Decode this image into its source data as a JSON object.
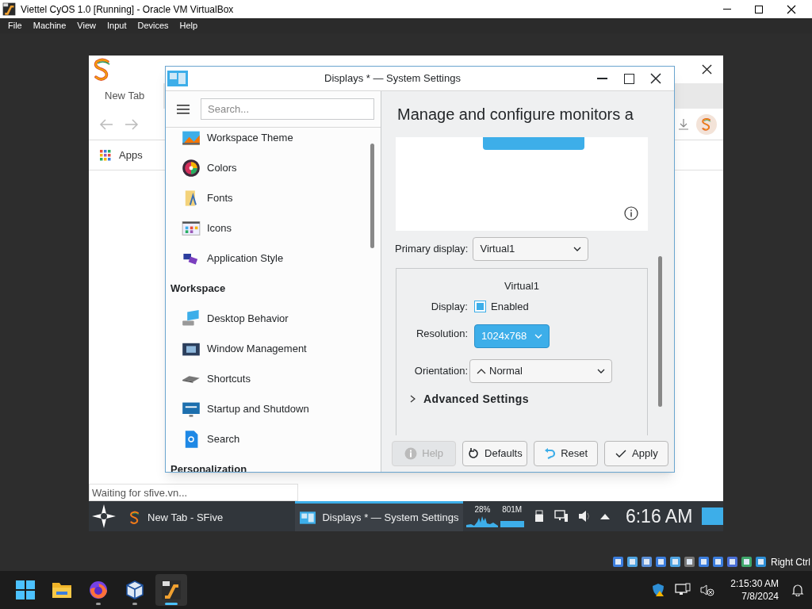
{
  "vbox": {
    "title": "Viettel CyOS 1.0 [Running] - Oracle VM VirtualBox",
    "menu": [
      "File",
      "Machine",
      "View",
      "Input",
      "Devices",
      "Help"
    ],
    "host_key": "Right Ctrl"
  },
  "browser": {
    "tab": "New Tab",
    "bookmarks": [
      "Apps"
    ],
    "status": "Waiting for sfive.vn..."
  },
  "settings": {
    "title": "Displays * — System Settings",
    "search": {
      "placeholder": "Search..."
    },
    "sidebar": [
      {
        "kind": "item",
        "label": "Workspace Theme"
      },
      {
        "kind": "item",
        "label": "Colors"
      },
      {
        "kind": "item",
        "label": "Fonts"
      },
      {
        "kind": "item",
        "label": "Icons"
      },
      {
        "kind": "item",
        "label": "Application Style"
      },
      {
        "kind": "header",
        "label": "Workspace"
      },
      {
        "kind": "item",
        "label": "Desktop Behavior"
      },
      {
        "kind": "item",
        "label": "Window Management"
      },
      {
        "kind": "item",
        "label": "Shortcuts"
      },
      {
        "kind": "item",
        "label": "Startup and Shutdown"
      },
      {
        "kind": "item",
        "label": "Search"
      },
      {
        "kind": "header",
        "label": "Personalization"
      }
    ],
    "heading": "Manage and configure monitors a",
    "primary_display": {
      "label": "Primary display:",
      "value": "Virtual1"
    },
    "output": {
      "name": "Virtual1",
      "display_label": "Display:",
      "enabled_label": "Enabled",
      "enabled": true,
      "resolution_label": "Resolution:",
      "resolution": "1024x768",
      "orientation_label": "Orientation:",
      "orientation": "Normal",
      "advanced": {
        "label": "Advanced Settings",
        "expanded": false
      }
    },
    "buttons": [
      {
        "label": "Help",
        "disabled": true
      },
      {
        "label": "Defaults",
        "disabled": false
      },
      {
        "label": "Reset",
        "disabled": false
      },
      {
        "label": "Apply",
        "disabled": false
      }
    ]
  },
  "guest_taskbar": {
    "tasks": [
      {
        "label": "New Tab - SFive",
        "selected": false
      },
      {
        "label": "Displays * — System Settings",
        "selected": true
      }
    ],
    "cpu": "28%",
    "memory": "801M",
    "clock": "6:16 AM"
  },
  "host_taskbar": {
    "apps": [
      {
        "running": false,
        "selected": false
      },
      {
        "running": true,
        "selected": false
      },
      {
        "running": true,
        "selected": false
      },
      {
        "running": true,
        "selected": true
      }
    ],
    "time": "2:15:30 AM",
    "date": "7/8/2024"
  }
}
